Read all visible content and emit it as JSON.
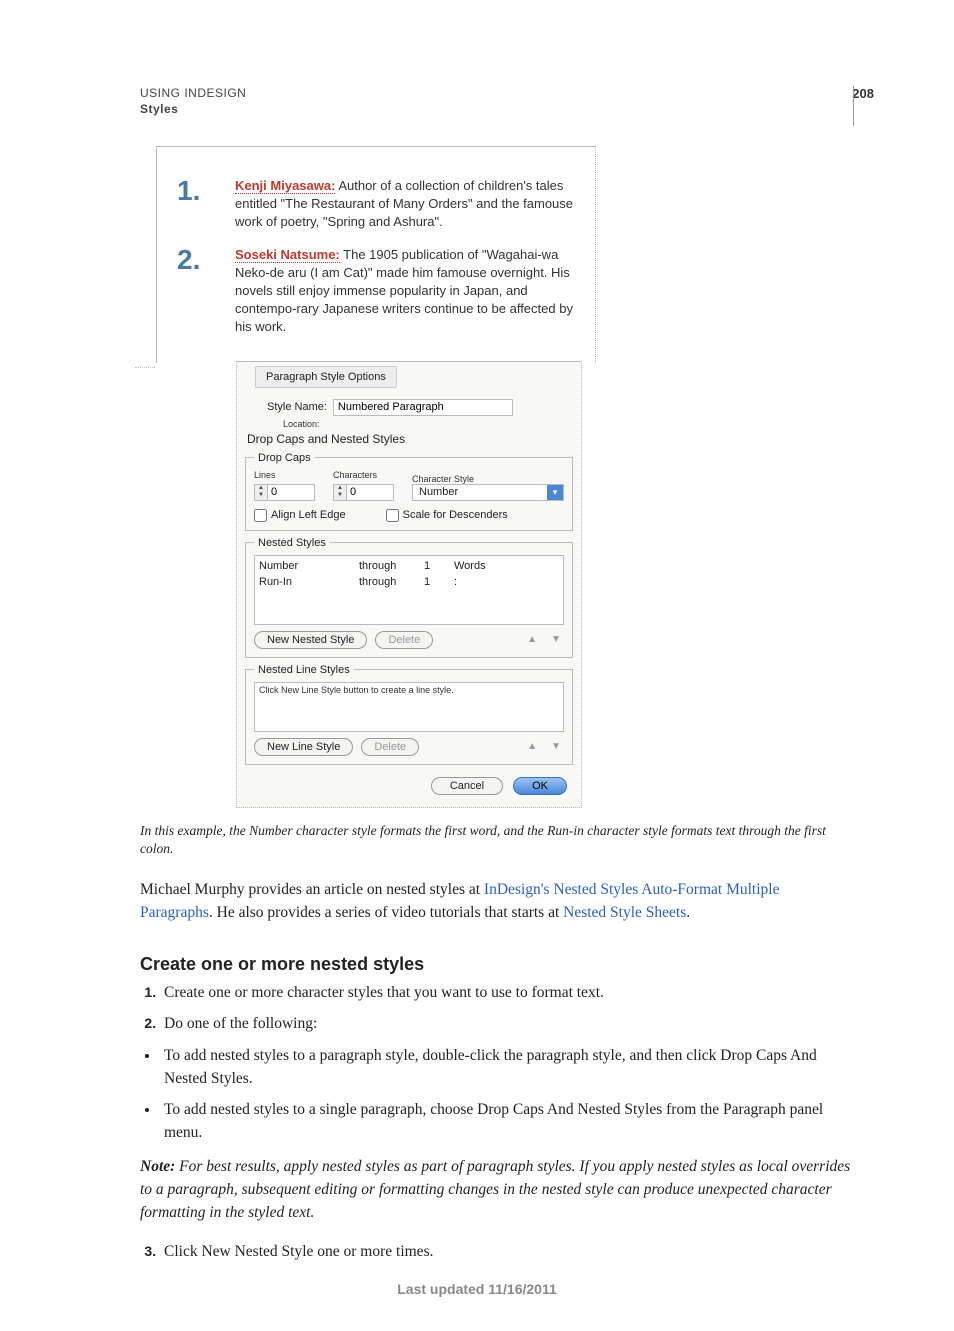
{
  "page_number": "208",
  "running_head": {
    "line1": "USING INDESIGN",
    "line2": "Styles"
  },
  "sample": {
    "item1_num": "1.",
    "item1_runin": "Kenji Miyasawa:",
    "item1_body": " Author of a collection of children's tales entitled \"The Restaurant of Many Orders\" and the famouse work of poetry, \"Spring and Ashura\".",
    "item2_num": "2.",
    "item2_runin": "Soseki Natsume:",
    "item2_body": " The 1905 publication of \"Wagahai-wa Neko-de aru (I am Cat)\" made him famouse overnight. His novels still enjoy immense popularity in Japan, and contempo-rary Japanese writers continue to be affected by his work."
  },
  "dialog": {
    "title": "Paragraph Style Options",
    "style_name_label": "Style Name:",
    "style_name_value": "Numbered Paragraph",
    "location_label": "Location:",
    "panel_heading": "Drop Caps and Nested Styles",
    "dropcaps": {
      "legend": "Drop Caps",
      "lines_label": "Lines",
      "lines_value": "0",
      "chars_label": "Characters",
      "chars_value": "0",
      "cstyle_label": "Character Style",
      "cstyle_value": "Number",
      "align_left_label": "Align Left Edge",
      "scale_desc_label": "Scale for Descenders"
    },
    "nested": {
      "legend": "Nested Styles",
      "rows": [
        {
          "style": "Number",
          "rel": "through",
          "count": "1",
          "unit": "Words"
        },
        {
          "style": "Run-In",
          "rel": "through",
          "count": "1",
          "unit": ":"
        }
      ],
      "new_btn": "New Nested Style",
      "delete_btn": "Delete"
    },
    "nested_lines": {
      "legend": "Nested Line Styles",
      "hint": "Click New Line Style button to create a line style.",
      "new_btn": "New Line Style",
      "delete_btn": "Delete"
    },
    "cancel": "Cancel",
    "ok": "OK"
  },
  "caption": "In this example, the Number character style formats the first word, and the Run-in character style formats text through the first colon.",
  "para1a": "Michael Murphy provides an article on nested styles at  ",
  "link1": "InDesign's Nested Styles Auto-Format Multiple Paragraphs",
  "para1b": ". He also provides a series of video tutorials that starts at ",
  "link2": "Nested Style Sheets",
  "para1c": ".",
  "section_heading": "Create one or more nested styles",
  "steps": {
    "s1": "Create one or more character styles that you want to use to format text.",
    "s2": "Do one of the following:",
    "b1": "To add nested styles to a paragraph style, double-click the paragraph style, and then click Drop Caps And Nested Styles.",
    "b2": "To add nested styles to a single paragraph, choose Drop Caps And Nested Styles from the Paragraph panel menu.",
    "note_label": "Note:",
    "note_body": " For best results, apply nested styles as part of paragraph styles. If you apply nested styles as local overrides to a paragraph, subsequent editing or formatting changes in the nested style can produce unexpected character formatting in the styled text.",
    "s3": "Click New Nested Style one or more times."
  },
  "footer": "Last updated 11/16/2011"
}
